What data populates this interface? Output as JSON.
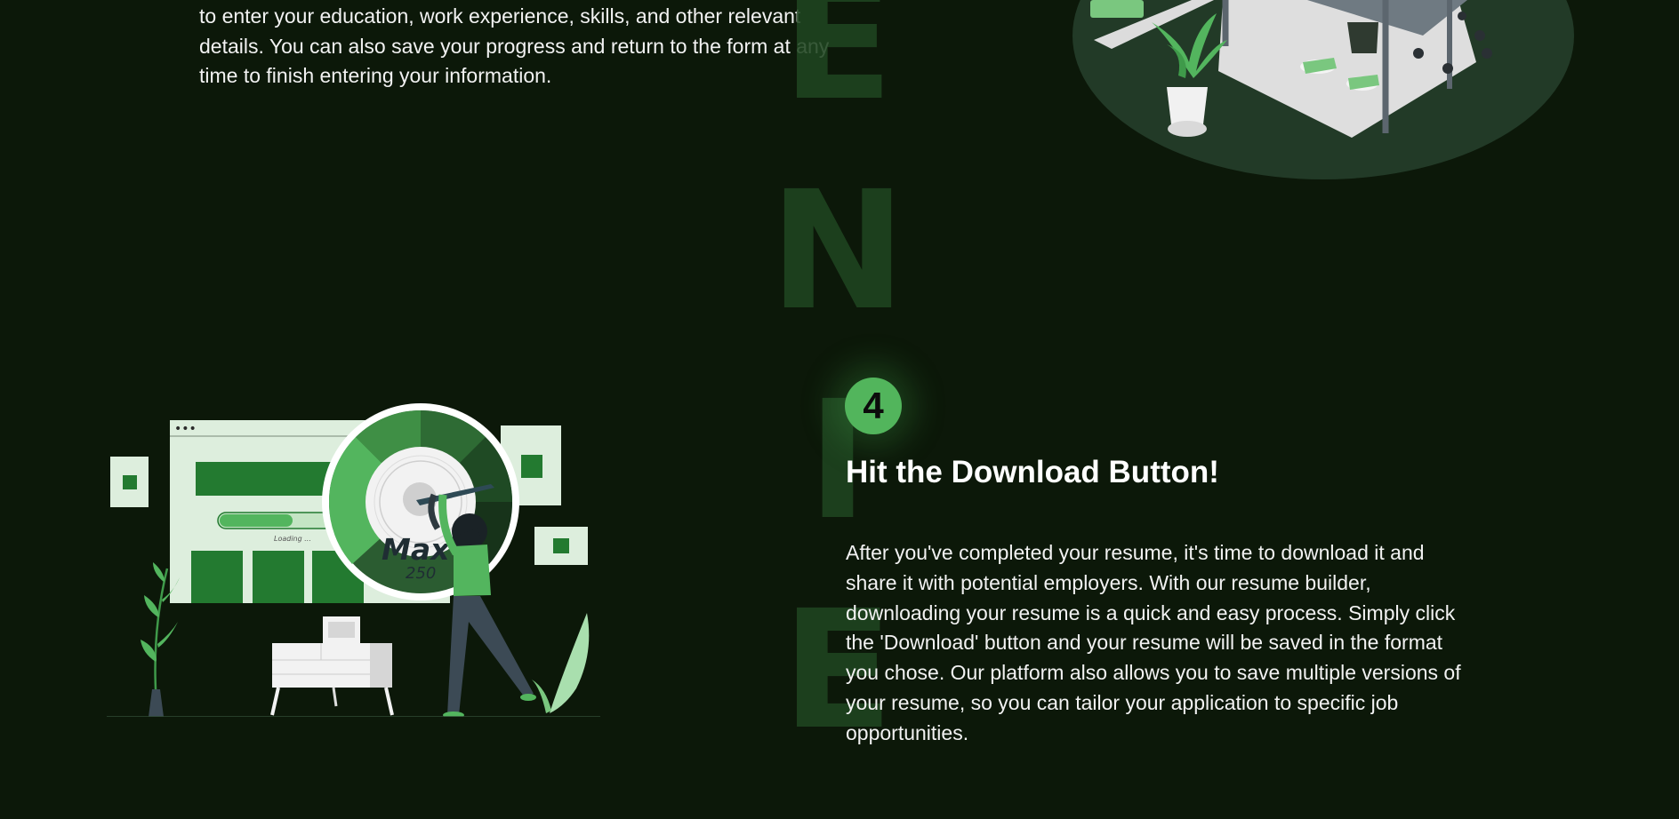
{
  "previous_step": {
    "description": "to enter your education, work experience, skills, and other relevant details. You can also save your progress and return to the form at any time to finish entering your information."
  },
  "decor": {
    "vertical_word": "ENIE"
  },
  "illustration_bottom": {
    "window_dots": "•••",
    "loading_label": "Loading ...",
    "gauge_label": "Max",
    "gauge_value": "250"
  },
  "step": {
    "number": "4",
    "title": "Hit the Download Button!",
    "description": "After you've completed your resume, it's time to download it and share it with potential employers. With our resume builder, downloading your resume is a quick and easy process. Simply click the 'Download' button and your resume will be saved in the format you chose. Our platform also allows you to save multiple versions of your resume, so you can tailor your application to specific job opportunities."
  },
  "colors": {
    "background": "#0c1809",
    "accent_green": "#52b55c",
    "dark_green": "#237a30",
    "decor_text": "#1f4520"
  }
}
